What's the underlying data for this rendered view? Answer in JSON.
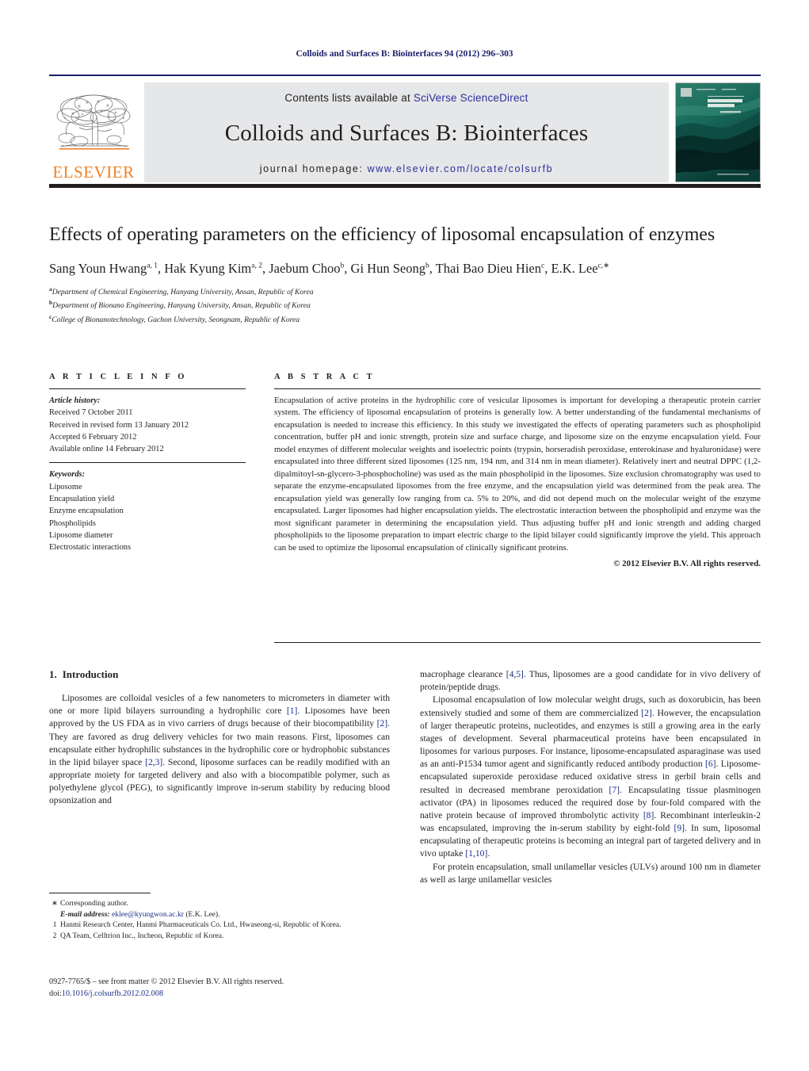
{
  "running_head": "Colloids and Surfaces B: Biointerfaces 94 (2012) 296–303",
  "masthead": {
    "publisher_name": "ELSEVIER",
    "contents_prefix": "Contents lists available at ",
    "contents_link": "SciVerse ScienceDirect",
    "journal_title": "Colloids and Surfaces B: Biointerfaces",
    "homepage_prefix": "journal homepage: ",
    "homepage_link": "www.elsevier.com/locate/colsurfb",
    "cover_title_line1": "COLLOIDS AND",
    "cover_title_line2": "SURFACES B",
    "cover_subtitle": "Biointerfaces"
  },
  "article": {
    "title": "Effects of operating parameters on the efficiency of liposomal encapsulation of enzymes",
    "authors_html": "Sang Youn Hwang<sup>a, 1</sup>, Hak Kyung Kim<sup>a, 2</sup>, Jaebum Choo<sup>b</sup>, Gi Hun Seong<sup>b</sup>, Thai Bao Dieu Hien<sup>c</sup>, E.K. Lee<sup>c,∗</sup>",
    "affiliations": [
      {
        "mark": "a",
        "text": "Department of Chemical Engineering, Hanyang University, Ansan, Republic of Korea"
      },
      {
        "mark": "b",
        "text": "Department of Bionano Engineering, Hanyang University, Ansan, Republic of Korea"
      },
      {
        "mark": "c",
        "text": "College of Bionanotechnology, Gachon University, Seongnam, Republic of Korea"
      }
    ]
  },
  "article_info": {
    "heading": "A R T I C L E    I N F O",
    "history_label": "Article history:",
    "history": [
      "Received 7 October 2011",
      "Received in revised form 13 January 2012",
      "Accepted 6 February 2012",
      "Available online 14 February 2012"
    ],
    "keywords_label": "Keywords:",
    "keywords": [
      "Liposome",
      "Encapsulation yield",
      "Enzyme encapsulation",
      "Phospholipids",
      "Liposome diameter",
      "Electrostatic interactions"
    ]
  },
  "abstract": {
    "heading": "A B S T R A C T",
    "text": "Encapsulation of active proteins in the hydrophilic core of vesicular liposomes is important for developing a therapeutic protein carrier system. The efficiency of liposomal encapsulation of proteins is generally low. A better understanding of the fundamental mechanisms of encapsulation is needed to increase this efficiency. In this study we investigated the effects of operating parameters such as phospholipid concentration, buffer pH and ionic strength, protein size and surface charge, and liposome size on the enzyme encapsulation yield. Four model enzymes of different molecular weights and isoelectric points (trypsin, horseradish peroxidase, enterokinase and hyaluronidase) were encapsulated into three different sized liposomes (125 nm, 194 nm, and 314 nm in mean diameter). Relatively inert and neutral DPPC (1,2-dipalmitoyl-sn-glycero-3-phosphocholine) was used as the main phospholipid in the liposomes. Size exclusion chromatography was used to separate the enzyme-encapsulated liposomes from the free enzyme, and the encapsulation yield was determined from the peak area. The encapsulation yield was generally low ranging from ca. 5% to 20%, and did not depend much on the molecular weight of the enzyme encapsulated. Larger liposomes had higher encapsulation yields. The electrostatic interaction between the phospholipid and enzyme was the most significant parameter in determining the encapsulation yield. Thus adjusting buffer pH and ionic strength and adding charged phospholipids to the liposome preparation to impart electric charge to the lipid bilayer could significantly improve the yield. This approach can be used to optimize the liposomal encapsulation of clinically significant proteins.",
    "copyright": "© 2012 Elsevier B.V. All rights reserved."
  },
  "introduction": {
    "number": "1.",
    "title": "Introduction",
    "left_paragraph_html": "Liposomes are colloidal vesicles of a few nanometers to micrometers in diameter with one or more lipid bilayers surrounding a hydrophilic core <span class=\"ref\">[1]</span>. Liposomes have been approved by the US FDA as in vivo carriers of drugs because of their biocompatibility <span class=\"ref\">[2]</span>. They are favored as drug delivery vehicles for two main reasons. First, liposomes can encapsulate either hydrophilic substances in the hydrophilic core or hydrophobic substances in the lipid bilayer space <span class=\"ref\">[2,3]</span>. Second, liposome surfaces can be readily modified with an appropriate moiety for targeted delivery and also with a biocompatible polymer, such as polyethylene glycol (PEG), to significantly improve in-serum stability by reducing blood opsonization and",
    "right_paragraph1_html": "macrophage clearance <span class=\"ref\">[4,5]</span>. Thus, liposomes are a good candidate for in vivo delivery of protein/peptide drugs.",
    "right_paragraph2_html": "Liposomal encapsulation of low molecular weight drugs, such as doxorubicin, has been extensively studied and some of them are commercialized <span class=\"ref\">[2]</span>. However, the encapsulation of larger therapeutic proteins, nucleotides, and enzymes is still a growing area in the early stages of development. Several pharmaceutical proteins have been encapsulated in liposomes for various purposes. For instance, liposome-encapsulated asparaginase was used as an anti-P1534 tumor agent and significantly reduced antibody production <span class=\"ref\">[6]</span>. Liposome-encapsulated superoxide peroxidase reduced oxidative stress in gerbil brain cells and resulted in decreased membrane peroxidation <span class=\"ref\">[7]</span>. Encapsulating tissue plasminogen activator (tPA) in liposomes reduced the required dose by four-fold compared with the native protein because of improved thrombolytic activity <span class=\"ref\">[8]</span>. Recombinant interleukin-2 was encapsulated, improving the in-serum stability by eight-fold <span class=\"ref\">[9]</span>. In sum, liposomal encapsulating of therapeutic proteins is becoming an integral part of targeted delivery and in vivo uptake <span class=\"ref\">[1,10]</span>.",
    "right_paragraph3_html": "For protein encapsulation, small unilamellar vesicles (ULVs) around 100 nm in diameter as well as large unilamellar vesicles"
  },
  "footnotes": {
    "corresponding_mark": "∗",
    "corresponding_text": "Corresponding author.",
    "email_label": "E-mail address:",
    "email": "eklee@kyungwon.ac.kr",
    "email_suffix": "(E.K. Lee).",
    "note1_mark": "1",
    "note1_text": "Hanmi Research Center, Hanmi Pharmaceuticals Co. Ltd., Hwaseong-si, Republic of Korea.",
    "note2_mark": "2",
    "note2_text": "QA Team, Celltrion Inc., Incheon, Republic of Korea."
  },
  "imprint": {
    "line1": "0927-7765/$ – see front matter © 2012 Elsevier B.V. All rights reserved.",
    "doi_label": "doi:",
    "doi_value": "10.1016/j.colsurfb.2012.02.008"
  },
  "colors": {
    "header_blue": "#1b1f6b",
    "link_blue": "#2b2f9c",
    "ref_blue": "#1b2f8a",
    "elsevier_orange": "#f08222",
    "box_gray": "#e6e7e8",
    "rule_dark": "#231f20"
  }
}
